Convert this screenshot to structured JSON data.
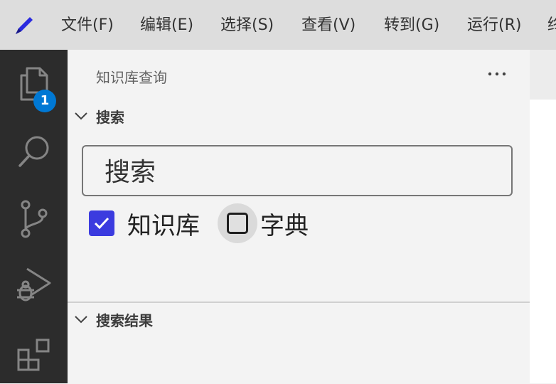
{
  "menubar": {
    "items": [
      "文件(F)",
      "编辑(E)",
      "选择(S)",
      "查看(V)",
      "转到(G)",
      "运行(R)",
      "终"
    ]
  },
  "activitybar": {
    "items": [
      "files-icon",
      "search-icon",
      "source-control-icon",
      "run-debug-icon",
      "extensions-icon"
    ],
    "explorer_badge": "1"
  },
  "sidebar": {
    "title": "知识库查询",
    "search_section": {
      "title": "搜索",
      "search_placeholder": "搜索",
      "search_value": "",
      "options": [
        {
          "label": "知识库",
          "checked": true
        },
        {
          "label": "字典",
          "checked": false
        }
      ]
    },
    "results_section": {
      "title": "搜索结果"
    }
  },
  "colors": {
    "accent": "#0078d4",
    "checkbox": "#3b3bdf",
    "activitybar_bg": "#2c2c2c",
    "sidebar_bg": "#f3f3f3"
  }
}
